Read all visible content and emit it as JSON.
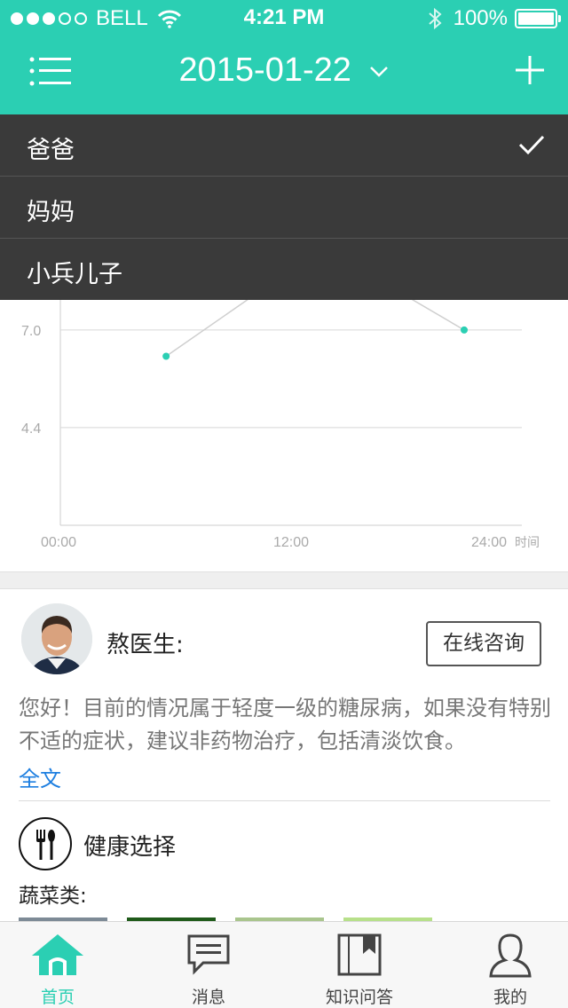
{
  "status_bar": {
    "carrier": "BELL",
    "time": "4:21 PM",
    "battery": "100%",
    "signal_bars_filled": 3,
    "signal_bars_total": 5
  },
  "header": {
    "title": "2015-01-22",
    "menu_icon": "list-menu-icon",
    "add_icon": "plus-icon",
    "accent_color": "#2bcfb3"
  },
  "dropdown": {
    "items": [
      {
        "label": "爸爸",
        "selected": true
      },
      {
        "label": "妈妈",
        "selected": false
      },
      {
        "label": "小兵儿子",
        "selected": false
      }
    ]
  },
  "chart_data": {
    "type": "line",
    "x_ticks": [
      "00:00",
      "12:00",
      "24:00"
    ],
    "x_unit": "时间",
    "y_ticks": [
      "7.0",
      "4.4"
    ],
    "xlim": [
      0,
      24
    ],
    "ylim": [
      1.8,
      7.8
    ],
    "series": [
      {
        "x": [
          5.5,
          10.0,
          18.0,
          21.0
        ],
        "y": [
          6.3,
          7.9,
          7.9,
          7.0
        ]
      }
    ],
    "color": "#2bcfb3"
  },
  "doctor": {
    "name": "熬医生:",
    "consult_label": "在线咨询",
    "advice": "您好！目前的情况属于轻度一级的糖尿病，如果没有特别不适的症状，建议非药物治疗，包括清淡饮食。",
    "full_text_link": "全文"
  },
  "health": {
    "title": "健康选择",
    "category": "蔬菜类:",
    "icon": "fork-spoon-icon"
  },
  "tabbar": {
    "tabs": [
      {
        "label": "首页",
        "icon": "home-icon",
        "active": true
      },
      {
        "label": "消息",
        "icon": "message-icon",
        "active": false
      },
      {
        "label": "知识问答",
        "icon": "book-icon",
        "active": false
      },
      {
        "label": "我的",
        "icon": "user-icon",
        "active": false
      }
    ]
  }
}
